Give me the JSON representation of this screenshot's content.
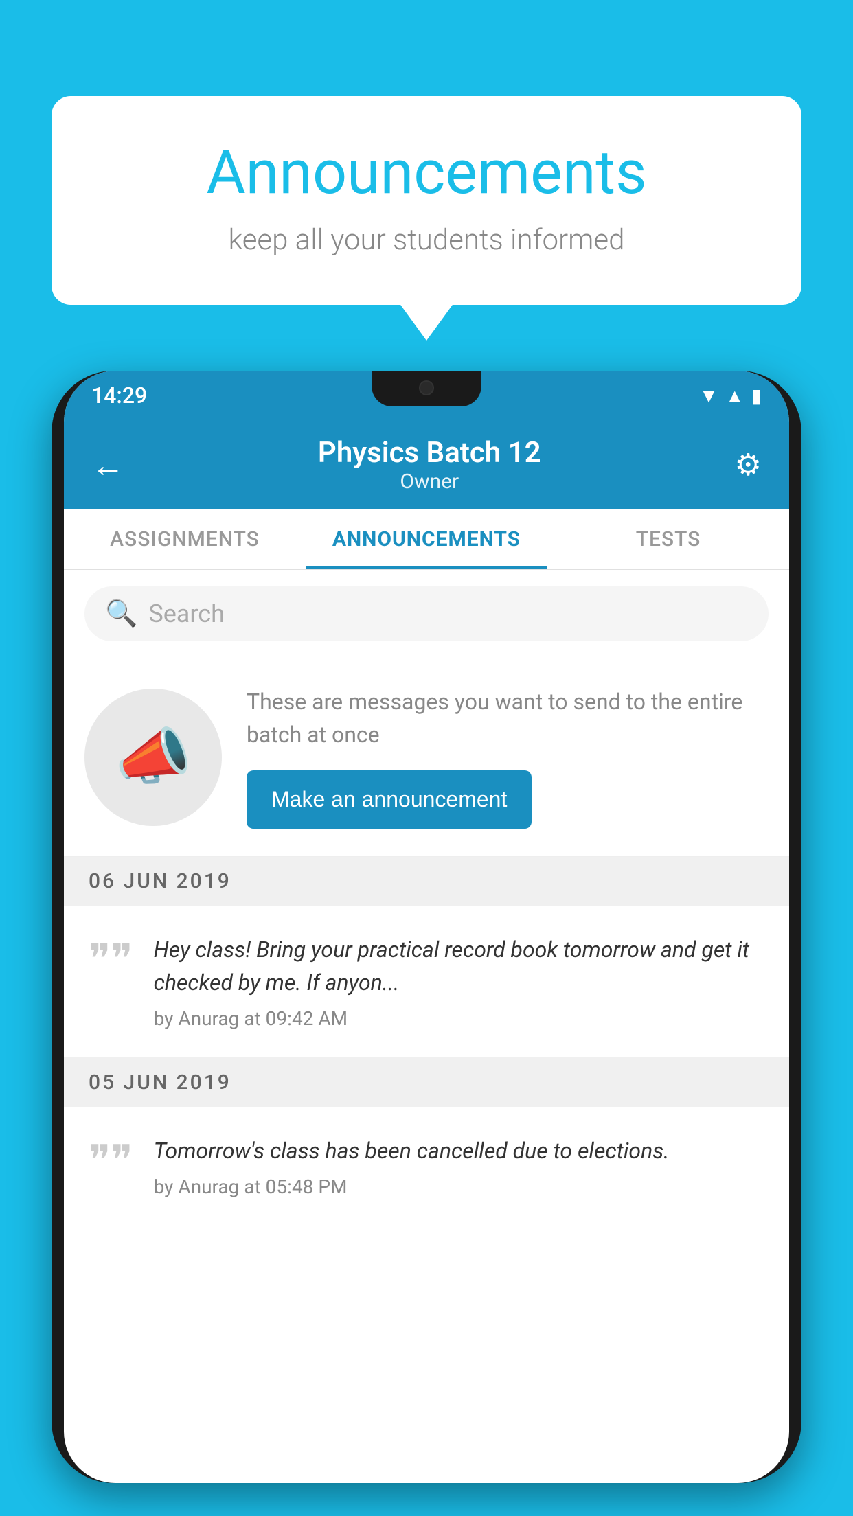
{
  "page": {
    "background_color": "#1ABDE8"
  },
  "speech_bubble": {
    "title": "Announcements",
    "subtitle": "keep all your students informed"
  },
  "phone": {
    "status_bar": {
      "time": "14:29",
      "wifi_icon": "wifi",
      "signal_icon": "signal",
      "battery_icon": "battery"
    },
    "header": {
      "back_label": "←",
      "title": "Physics Batch 12",
      "subtitle": "Owner",
      "settings_icon": "gear"
    },
    "tabs": [
      {
        "label": "ASSIGNMENTS",
        "active": false
      },
      {
        "label": "ANNOUNCEMENTS",
        "active": true
      },
      {
        "label": "TESTS",
        "active": false
      },
      {
        "label": "...",
        "active": false
      }
    ],
    "search": {
      "placeholder": "Search"
    },
    "promo": {
      "description": "These are messages you want to send to the entire batch at once",
      "button_label": "Make an announcement"
    },
    "announcements": [
      {
        "date": "06  JUN  2019",
        "text": "Hey class! Bring your practical record book tomorrow and get it checked by me. If anyon...",
        "author": "by Anurag at 09:42 AM"
      },
      {
        "date": "05  JUN  2019",
        "text": "Tomorrow's class has been cancelled due to elections.",
        "author": "by Anurag at 05:48 PM"
      }
    ]
  }
}
